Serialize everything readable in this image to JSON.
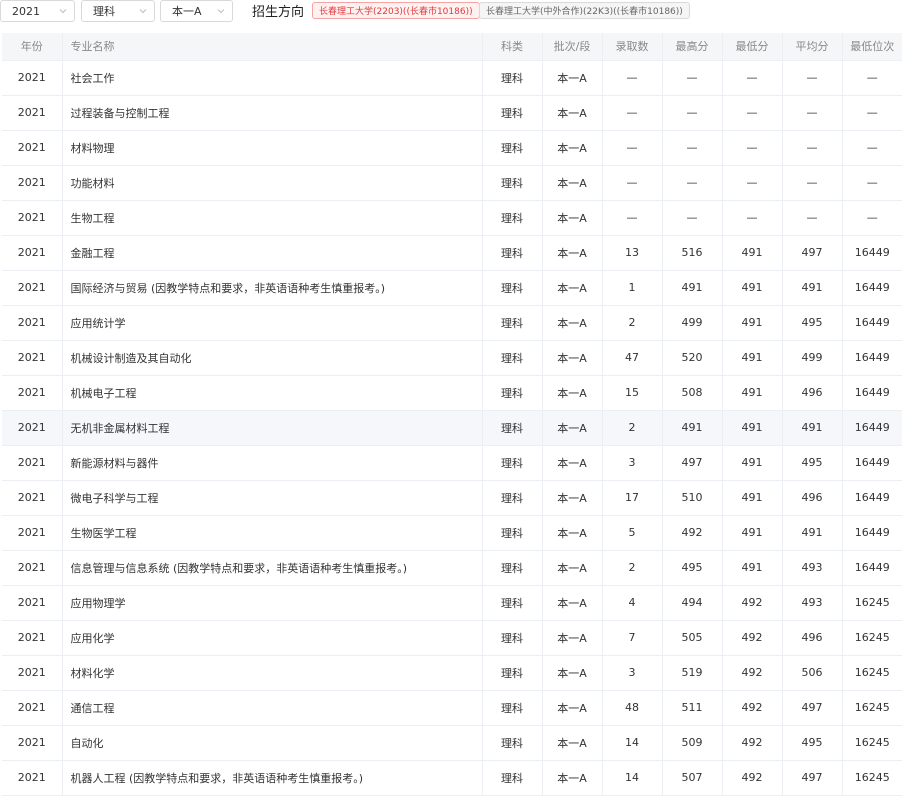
{
  "filters": {
    "year": "2021",
    "category": "理科",
    "batch": "本一A",
    "direction_label": "招生方向",
    "tags": [
      {
        "label": "长春理工大学(2203)((长春市10186))",
        "active": true
      },
      {
        "label": "长春理工大学(中外合作)(22K3)((长春市10186))",
        "active": false
      }
    ]
  },
  "colors": {
    "active_tag": "#e0393e",
    "header_bg": "#f5f6f8",
    "row_highlight": "#f5f7fb"
  },
  "table": {
    "headers": [
      "年份",
      "专业名称",
      "科类",
      "批次/段",
      "录取数",
      "最高分",
      "最低分",
      "平均分",
      "最低位次"
    ],
    "rows": [
      [
        "2021",
        "社会工作",
        "理科",
        "本一A",
        "—",
        "—",
        "—",
        "—",
        "—"
      ],
      [
        "2021",
        "过程装备与控制工程",
        "理科",
        "本一A",
        "—",
        "—",
        "—",
        "—",
        "—"
      ],
      [
        "2021",
        "材料物理",
        "理科",
        "本一A",
        "—",
        "—",
        "—",
        "—",
        "—"
      ],
      [
        "2021",
        "功能材料",
        "理科",
        "本一A",
        "—",
        "—",
        "—",
        "—",
        "—"
      ],
      [
        "2021",
        "生物工程",
        "理科",
        "本一A",
        "—",
        "—",
        "—",
        "—",
        "—"
      ],
      [
        "2021",
        "金融工程",
        "理科",
        "本一A",
        "13",
        "516",
        "491",
        "497",
        "16449"
      ],
      [
        "2021",
        "国际经济与贸易 (因教学特点和要求，非英语语种考生慎重报考。)",
        "理科",
        "本一A",
        "1",
        "491",
        "491",
        "491",
        "16449"
      ],
      [
        "2021",
        "应用统计学",
        "理科",
        "本一A",
        "2",
        "499",
        "491",
        "495",
        "16449"
      ],
      [
        "2021",
        "机械设计制造及其自动化",
        "理科",
        "本一A",
        "47",
        "520",
        "491",
        "499",
        "16449"
      ],
      [
        "2021",
        "机械电子工程",
        "理科",
        "本一A",
        "15",
        "508",
        "491",
        "496",
        "16449"
      ],
      [
        "2021",
        "无机非金属材料工程",
        "理科",
        "本一A",
        "2",
        "491",
        "491",
        "491",
        "16449"
      ],
      [
        "2021",
        "新能源材料与器件",
        "理科",
        "本一A",
        "3",
        "497",
        "491",
        "495",
        "16449"
      ],
      [
        "2021",
        "微电子科学与工程",
        "理科",
        "本一A",
        "17",
        "510",
        "491",
        "496",
        "16449"
      ],
      [
        "2021",
        "生物医学工程",
        "理科",
        "本一A",
        "5",
        "492",
        "491",
        "491",
        "16449"
      ],
      [
        "2021",
        "信息管理与信息系统 (因教学特点和要求，非英语语种考生慎重报考。)",
        "理科",
        "本一A",
        "2",
        "495",
        "491",
        "493",
        "16449"
      ],
      [
        "2021",
        "应用物理学",
        "理科",
        "本一A",
        "4",
        "494",
        "492",
        "493",
        "16245"
      ],
      [
        "2021",
        "应用化学",
        "理科",
        "本一A",
        "7",
        "505",
        "492",
        "496",
        "16245"
      ],
      [
        "2021",
        "材料化学",
        "理科",
        "本一A",
        "3",
        "519",
        "492",
        "506",
        "16245"
      ],
      [
        "2021",
        "通信工程",
        "理科",
        "本一A",
        "48",
        "511",
        "492",
        "497",
        "16245"
      ],
      [
        "2021",
        "自动化",
        "理科",
        "本一A",
        "14",
        "509",
        "492",
        "495",
        "16245"
      ],
      [
        "2021",
        "机器人工程 (因教学特点和要求，非英语语种考生慎重报考。)",
        "理科",
        "本一A",
        "14",
        "507",
        "492",
        "497",
        "16245"
      ]
    ]
  }
}
